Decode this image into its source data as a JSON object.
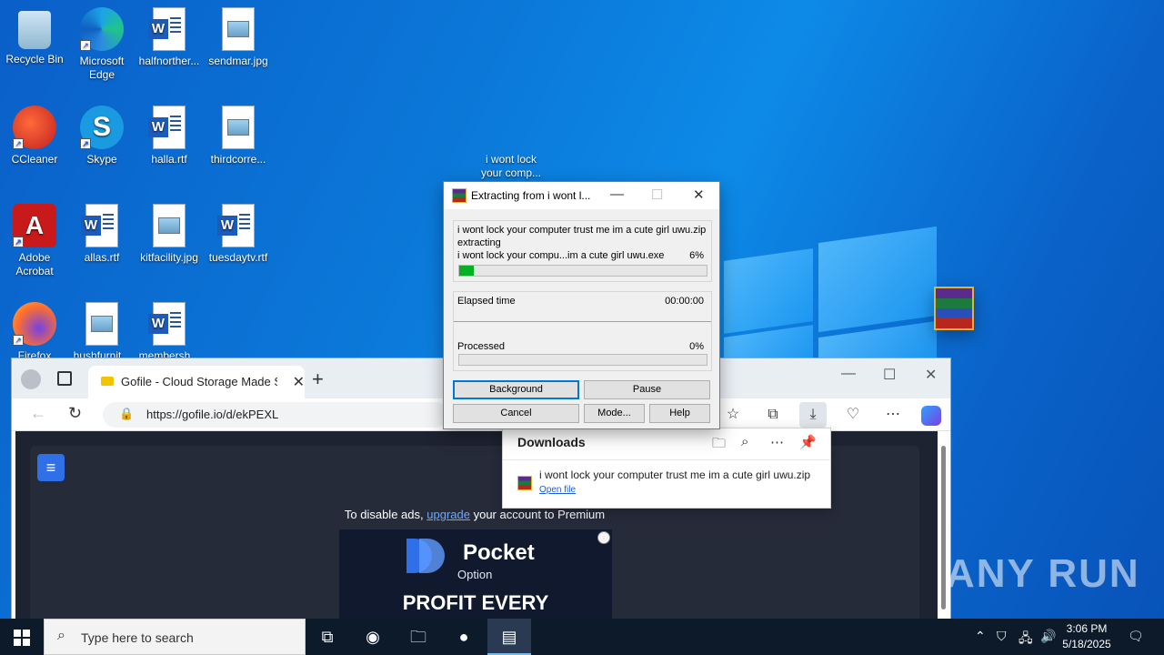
{
  "desktop": {
    "icons": [
      {
        "label": "Recycle Bin"
      },
      {
        "label": "Microsoft Edge"
      },
      {
        "label": "halfnorther..."
      },
      {
        "label": "sendmar.jpg"
      },
      {
        "label": "CCleaner"
      },
      {
        "label": "Skype"
      },
      {
        "label": "halla.rtf"
      },
      {
        "label": "thirdcorre..."
      },
      {
        "label": "i wont lock your comp..."
      },
      {
        "label": "Adobe Acrobat"
      },
      {
        "label": "allas.rtf"
      },
      {
        "label": "kitfacility.jpg"
      },
      {
        "label": "tuesdaytv.rtf"
      },
      {
        "label": "Firefox"
      },
      {
        "label": "hushfurnit..."
      },
      {
        "label": "membersh..."
      }
    ]
  },
  "browser": {
    "tab_title": "Gofile - Cloud Storage Made Simple",
    "url": "https://gofile.io/d/ekPEXL",
    "ads_prefix": "To disable ads,",
    "ads_link": "upgrade",
    "ads_suffix": "your account to Premium",
    "ad_brand": "Pocket",
    "ad_brand_sub": "Option",
    "ad_headline": "PROFIT EVERY"
  },
  "downloads": {
    "title": "Downloads",
    "file_name": "i wont lock your computer trust me im a cute girl uwu.zip",
    "open_file": "Open file"
  },
  "winrar": {
    "title": "Extracting from i wont l...",
    "archive": "i wont lock your computer trust me im a cute girl uwu.zip",
    "action": "extracting",
    "current_file": "i wont lock your compu...im a cute girl uwu.exe",
    "file_percent": "6%",
    "file_progress": 0.06,
    "elapsed_label": "Elapsed time",
    "elapsed_value": "00:00:00",
    "processed_label": "Processed",
    "processed_value": "0%",
    "processed_progress": 0.0,
    "buttons": {
      "background": "Background",
      "pause": "Pause",
      "cancel": "Cancel",
      "mode": "Mode...",
      "help": "Help"
    }
  },
  "taskbar": {
    "search_placeholder": "Type here to search",
    "time": "3:06 PM",
    "date": "5/18/2025"
  },
  "watermark": "ANY RUN"
}
